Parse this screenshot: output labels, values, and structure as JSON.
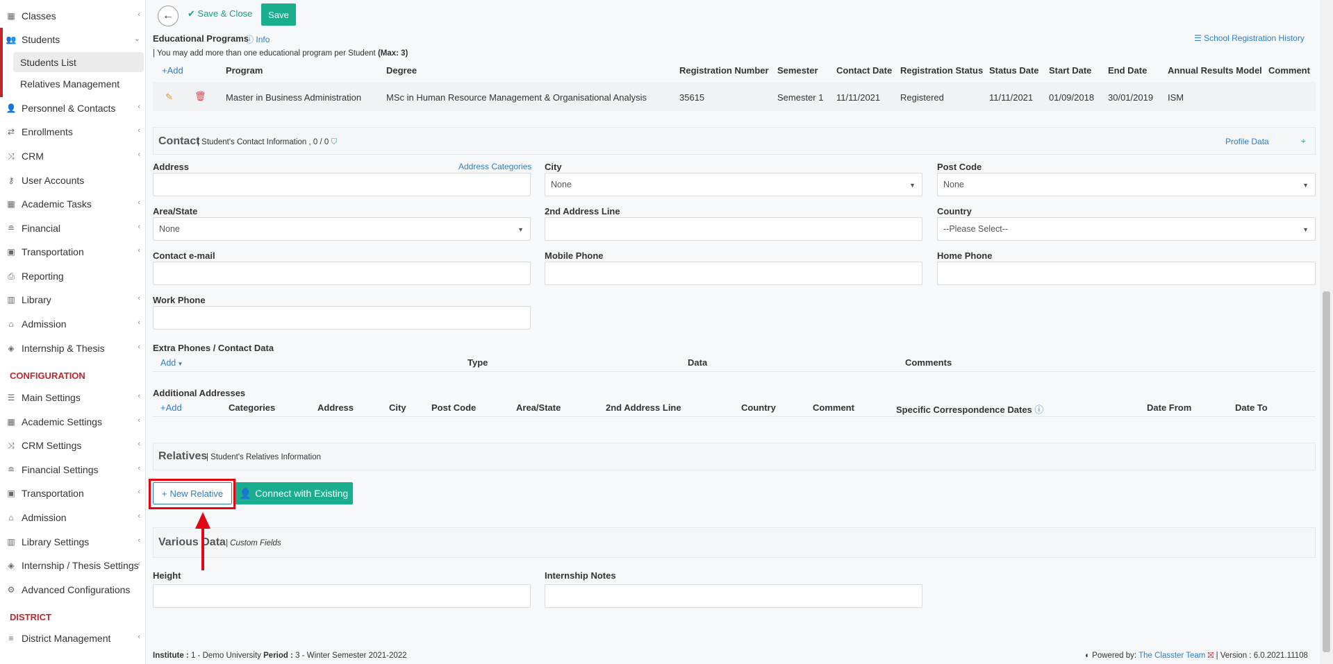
{
  "sidebar": {
    "items": [
      {
        "label": "Classes"
      },
      {
        "label": "Students"
      },
      {
        "label": "Personnel & Contacts"
      },
      {
        "label": "Enrollments"
      },
      {
        "label": "CRM"
      },
      {
        "label": "User Accounts"
      },
      {
        "label": "Academic Tasks"
      },
      {
        "label": "Financial"
      },
      {
        "label": "Transportation"
      },
      {
        "label": "Reporting"
      },
      {
        "label": "Library"
      },
      {
        "label": "Admission"
      },
      {
        "label": "Internship & Thesis"
      }
    ],
    "students_sub": [
      {
        "label": "Students List"
      },
      {
        "label": "Relatives Management"
      }
    ],
    "configuration_title": "CONFIGURATION",
    "config_items": [
      {
        "label": "Main Settings"
      },
      {
        "label": "Academic Settings"
      },
      {
        "label": "CRM Settings"
      },
      {
        "label": "Financial Settings"
      },
      {
        "label": "Transportation"
      },
      {
        "label": "Admission"
      },
      {
        "label": "Library Settings"
      },
      {
        "label": "Internship / Thesis Settings"
      },
      {
        "label": "Advanced Configurations"
      }
    ],
    "district_title": "DISTRICT",
    "district_items": [
      {
        "label": "District Management"
      }
    ]
  },
  "toolbar": {
    "save_close_label": "Save & Close",
    "save_label": "Save"
  },
  "programs": {
    "title": "Educational Programs",
    "info_label": "Info",
    "history_link": "School Registration History",
    "note": "| You may add more than one educational program per Student",
    "note_max": "(Max: 3)",
    "add_label": "Add",
    "columns": [
      "Program",
      "Degree",
      "Registration Number",
      "Semester",
      "Contact Date",
      "Registration Status",
      "Status Date",
      "Start Date",
      "End Date",
      "Annual Results Model",
      "Comment"
    ],
    "row": {
      "program": "Master in Business Administration",
      "degree": "MSc in Human Resource Management & Organisational Analysis",
      "registration_number": "35615",
      "semester": "Semester 1",
      "contact_date": "11/11/2021",
      "registration_status": "Registered",
      "status_date": "11/11/2021",
      "start_date": "01/09/2018",
      "end_date": "30/01/2019",
      "annual_results_model": "ISM",
      "comment": ""
    }
  },
  "contact": {
    "title": "Contact",
    "subtitle": "| Student's Contact Information , 0 / 0",
    "profile_data_link": "Profile Data",
    "fields": {
      "address_label": "Address",
      "address_categories_link": "Address Categories",
      "city_label": "City",
      "city_value": "None",
      "post_code_label": "Post Code",
      "post_code_value": "None",
      "area_state_label": "Area/State",
      "area_state_value": "None",
      "address2_label": "2nd Address Line",
      "country_label": "Country",
      "country_value": "--Please Select--",
      "email_label": "Contact e-mail",
      "mobile_label": "Mobile Phone",
      "home_phone_label": "Home Phone",
      "work_phone_label": "Work Phone"
    },
    "extra_phones": {
      "title": "Extra Phones / Contact Data",
      "add_label": "Add",
      "columns": [
        "Type",
        "Data",
        "Comments"
      ]
    },
    "additional_addresses": {
      "title": "Additional Addresses",
      "add_label": "Add",
      "columns": [
        "Categories",
        "Address",
        "City",
        "Post Code",
        "Area/State",
        "2nd Address Line",
        "Country",
        "Comment",
        "Specific Correspondence Dates",
        "Date From",
        "Date To"
      ]
    }
  },
  "relatives": {
    "title": "Relatives",
    "subtitle": "| Student's Relatives Information",
    "new_relative_label": "New Relative",
    "connect_label": "Connect with Existing"
  },
  "various": {
    "title": "Various Data",
    "subtitle": "| Custom Fields",
    "height_label": "Height",
    "internship_notes_label": "Internship Notes"
  },
  "footer": {
    "institute_label": "Institute :",
    "institute_value": "1 - Demo University",
    "period_label": "Period :",
    "period_value": "3 - Winter Semester 2021-2022",
    "powered_by": "Powered by:",
    "powered_link": "The Classter Team",
    "version": "| Version : 6.0.2021.11108"
  },
  "colors": {
    "accent_green": "#1aae8f",
    "link_blue": "#2f7dc5",
    "brand_red": "#c0272d",
    "highlight_red": "#e30613"
  }
}
